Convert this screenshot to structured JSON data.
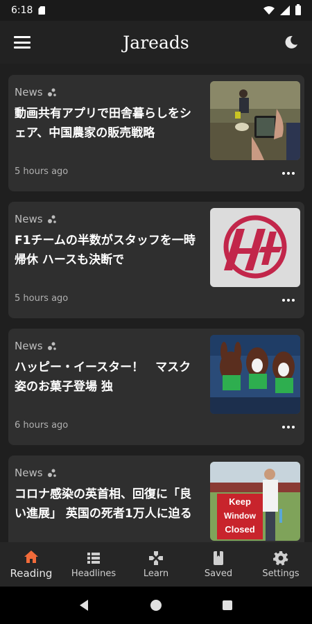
{
  "status": {
    "time": "6:18"
  },
  "app": {
    "title": "Jareads"
  },
  "articles": [
    {
      "source": "News",
      "title": "動画共有アプリで田舎暮らしをシェア、中国農家の販売戦略",
      "time": "5 hours ago"
    },
    {
      "source": "News",
      "title": "F1チームの半数がスタッフを一時帰休 ハースも決断で",
      "time": "5 hours ago"
    },
    {
      "source": "News",
      "title": "ハッピー・イースター！　マスク姿のお菓子登場 独",
      "time": "6 hours ago"
    },
    {
      "source": "News",
      "title": "コロナ感染の英首相、回復に「良い進展」 英国の死者1万人に迫る",
      "time": ""
    }
  ],
  "thumbs": {
    "sign_text_1": "Keep",
    "sign_text_2": "Window",
    "sign_text_3": "Closed"
  },
  "nav": [
    {
      "label": "Reading",
      "icon": "home-icon",
      "active": true
    },
    {
      "label": "Headlines",
      "icon": "list-icon"
    },
    {
      "label": "Learn",
      "icon": "gamepad-icon"
    },
    {
      "label": "Saved",
      "icon": "bookmark-icon"
    },
    {
      "label": "Settings",
      "icon": "gear-icon"
    }
  ],
  "colors": {
    "accent": "#f26b3a",
    "card": "#2f2f2f",
    "background": "#1f1f1f"
  }
}
